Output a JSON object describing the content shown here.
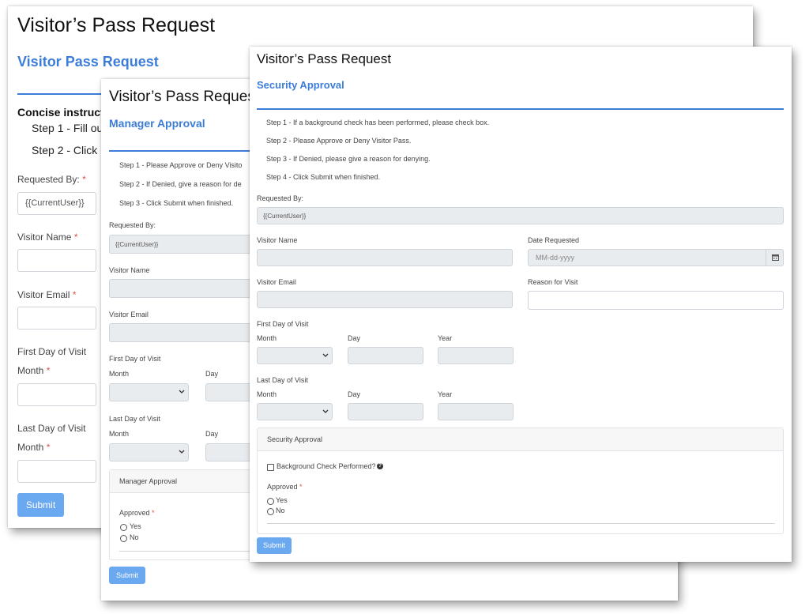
{
  "back_form": {
    "title": "Visitor’s Pass Request",
    "subtitle": "Visitor Pass Request",
    "instructions_heading": "Concise instructi",
    "step1": "Step 1 - Fill ou",
    "step2": "Step 2 - Click",
    "requested_by_label": "Requested By:",
    "requested_by_value": "{{CurrentUser}}",
    "visitor_name_label": "Visitor Name",
    "visitor_email_label": "Visitor Email",
    "first_day_label": "First Day of Visit",
    "month_label": "Month",
    "last_day_label": "Last Day of Visit",
    "month_label_2": "Month",
    "required_mark": "*",
    "submit_label": "Submit"
  },
  "manager_form": {
    "title": "Visitor’s Pass Reques",
    "subtitle": "Manager Approval",
    "step1": "Step 1 - Please Approve or Deny Visito",
    "step2": "Step 2 - If Denied, give a reason for de",
    "step3": "Step 3 - Click Submit when finished.",
    "requested_by_label": "Requested By:",
    "requested_by_value": "{{CurrentUser}}",
    "visitor_name_label": "Visitor Name",
    "visitor_email_label": "Visitor Email",
    "first_day_label": "First Day of Visit",
    "month_label": "Month",
    "day_label": "Day",
    "last_day_label": "Last Day of Visit",
    "month_label_2": "Month",
    "day_label_2": "Day",
    "panel_title": "Manager Approval",
    "approved_label": "Approved",
    "required_mark": "*",
    "yes_label": "Yes",
    "no_label": "No",
    "submit_label": "Submit"
  },
  "security_form": {
    "title": "Visitor’s Pass Request",
    "subtitle": "Security Approval",
    "step1": "Step 1 - If a background check has been performed, please check box.",
    "step2": "Step 2 - Please Approve or Deny Visitor Pass.",
    "step3": "Step 3 - If Denied, please give a reason for denying.",
    "step4": "Step 4 - Click Submit when finished.",
    "requested_by_label": "Requested By:",
    "requested_by_value": "{{CurrentUser}}",
    "visitor_name_label": "Visitor Name",
    "date_requested_label": "Date Requested",
    "date_placeholder": "MM-dd-yyyy",
    "visitor_email_label": "Visitor Email",
    "reason_label": "Reason for Visit",
    "first_day_label": "First Day of Visit",
    "month_label": "Month",
    "day_label": "Day",
    "year_label": "Year",
    "last_day_label": "Last Day of Visit",
    "month_label_2": "Month",
    "day_label_2": "Day",
    "year_label_2": "Year",
    "panel_title": "Security Approval",
    "background_check_label": "Background Check Performed?",
    "approved_label": "Approved",
    "required_mark": "*",
    "yes_label": "Yes",
    "no_label": "No",
    "submit_label": "Submit"
  },
  "colors": {
    "accent": "#3b7dd8",
    "button": "#6aa8ef",
    "required": "#d9534f"
  }
}
